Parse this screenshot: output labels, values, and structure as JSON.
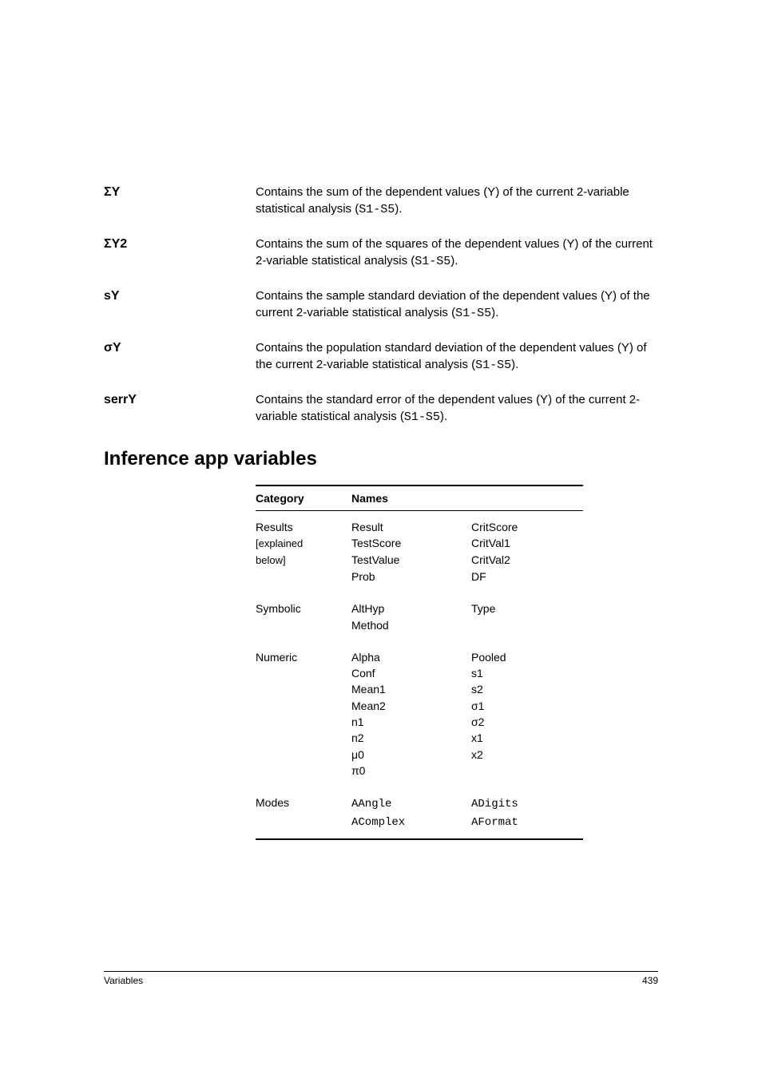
{
  "defs": [
    {
      "term_html": "Σ<b>Y</b>",
      "desc_html": "Contains the sum of the dependent values (Y) of the current 2-variable statistical analysis (<span class=\"mono\">S1-S5</span>)."
    },
    {
      "term_html": "Σ<b>Y2</b>",
      "desc_html": "Contains the sum of the squares of the dependent values (Y) of the current 2-variable statistical analysis (<span class=\"mono\">S1-S5</span>)."
    },
    {
      "term_html": "<b>sY</b>",
      "desc_html": "Contains the sample standard deviation of the dependent values (Y) of the current 2-variable statistical analysis (<span class=\"mono\">S1-S5</span>)."
    },
    {
      "term_html": "σ<b>Y</b>",
      "desc_html": "Contains the population standard deviation of the dependent values (Y) of the current 2-variable statistical analysis (<span class=\"mono\">S1-S5</span>)."
    },
    {
      "term_html": "<b>serrY</b>",
      "desc_html": "Contains the standard error of the dependent values (Y) of the current 2-variable statistical analysis (<span class=\"mono\">S1-S5</span>)."
    }
  ],
  "section_heading": "Inference app variables",
  "table": {
    "headers": {
      "cat": "Category",
      "names": "Names"
    },
    "rows": [
      {
        "cat_html": "Results",
        "n1": "Result",
        "n2": "CritScore",
        "first": true
      },
      {
        "cat_html": "<span class=\"sub\">[explained</span>",
        "n1": "TestScore",
        "n2": "CritVal1"
      },
      {
        "cat_html": "<span class=\"sub\">below]</span>",
        "n1": "TestValue",
        "n2": "CritVal2"
      },
      {
        "cat_html": "",
        "n1": "Prob",
        "n2": "DF",
        "last": true
      },
      {
        "cat_html": "Symbolic",
        "n1": "AltHyp",
        "n2": "Type",
        "first": true
      },
      {
        "cat_html": "",
        "n1": "Method",
        "n2": "",
        "last": true
      },
      {
        "cat_html": "Numeric",
        "n1": "Alpha",
        "n2": "Pooled",
        "first": true
      },
      {
        "cat_html": "",
        "n1": "Conf",
        "n2": "s1"
      },
      {
        "cat_html": "",
        "n1": "Mean1",
        "n2": "s2"
      },
      {
        "cat_html": "",
        "n1": "Mean2",
        "n2": "σ1"
      },
      {
        "cat_html": "",
        "n1": "n1",
        "n2": "σ2"
      },
      {
        "cat_html": "",
        "n1": "n2",
        "n2": "x1"
      },
      {
        "cat_html": "",
        "n1": "μ0",
        "n2": "x2"
      },
      {
        "cat_html": "",
        "n1": "π0",
        "n2": "",
        "last": true
      },
      {
        "cat_html": "Modes",
        "n1_html": "<span class=\"mono\">AAngle</span>",
        "n2_html": "<span class=\"mono\">ADigits</span>",
        "first": true
      },
      {
        "cat_html": "",
        "n1_html": "<span class=\"mono\">AComplex</span>",
        "n2_html": "<span class=\"mono\">AFormat</span>",
        "last": true
      }
    ]
  },
  "footer": {
    "left": "Variables",
    "right": "439"
  }
}
